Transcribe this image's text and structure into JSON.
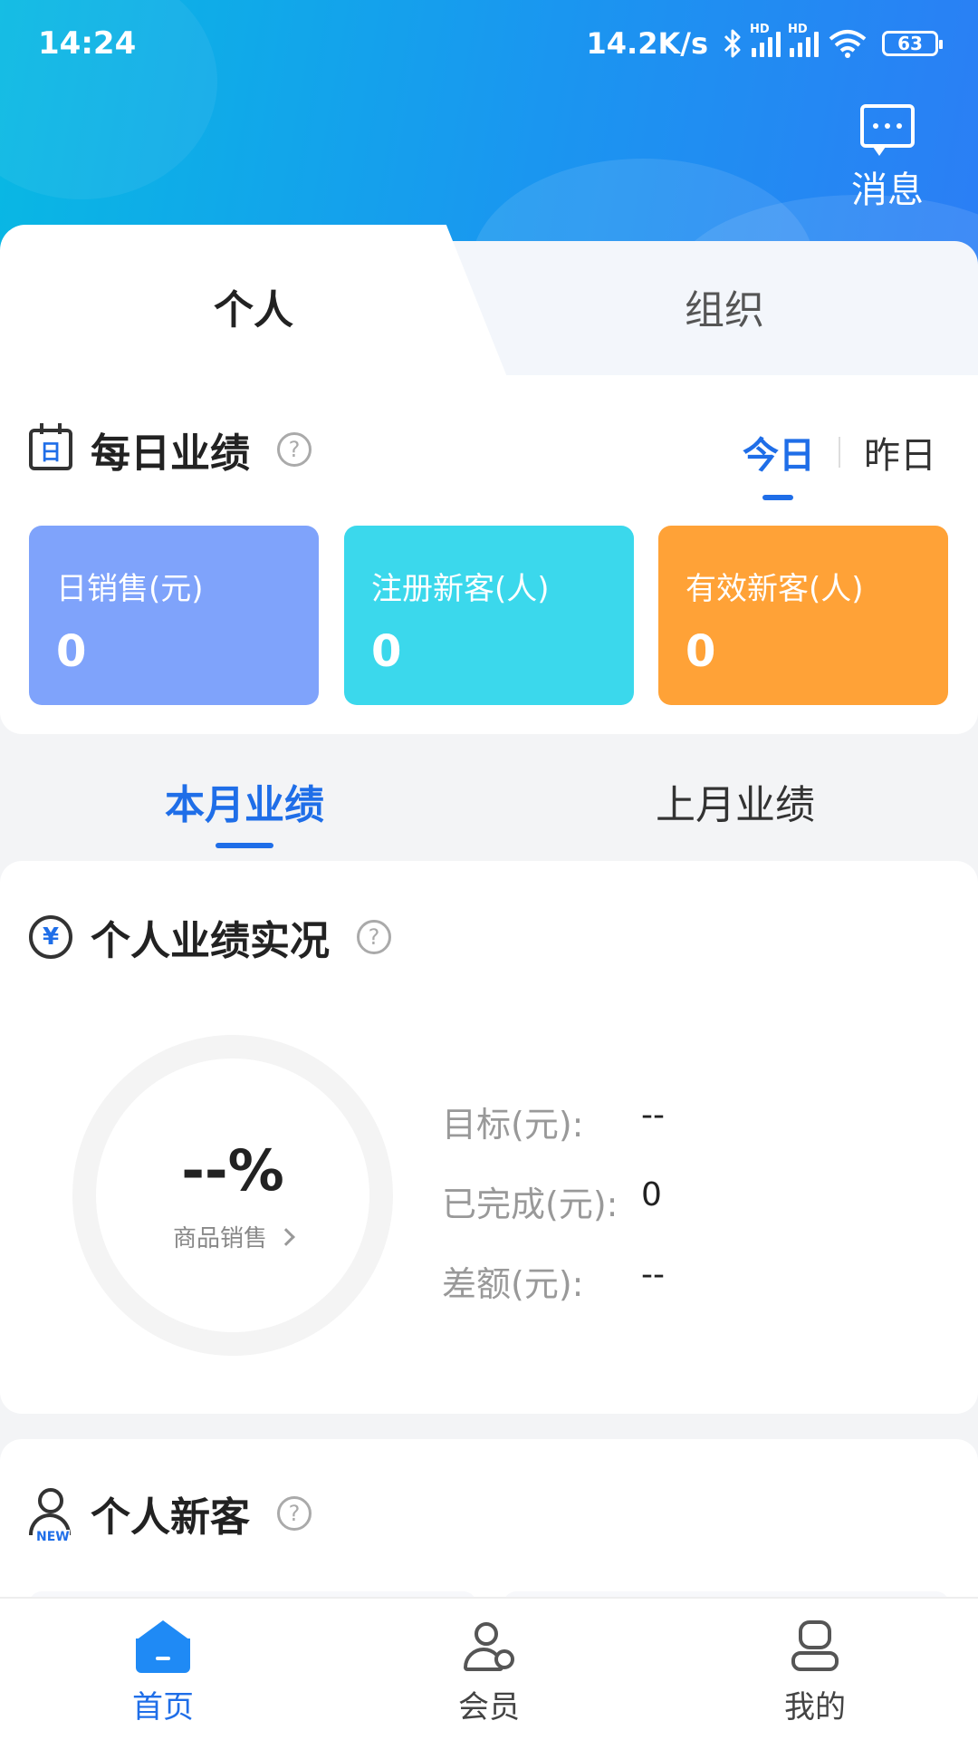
{
  "status_bar": {
    "time": "14:24",
    "net_speed": "14.2K/s",
    "hd1": "HD",
    "hd2": "HD",
    "battery": "63",
    "icons": [
      "bluetooth-icon",
      "signal-icon",
      "signal-icon",
      "wifi-icon",
      "battery-icon"
    ]
  },
  "header": {
    "message_label": "消息"
  },
  "scope_tabs": {
    "personal": "个人",
    "organization": "组织",
    "active": "personal"
  },
  "daily": {
    "title": "每日业绩",
    "calendar_glyph": "日",
    "help": "?",
    "today": "今日",
    "yesterday": "昨日",
    "active": "today",
    "stats": [
      {
        "label": "日销售(元)",
        "value": "0",
        "color": "#7fa3fb"
      },
      {
        "label": "注册新客(人)",
        "value": "0",
        "color": "#3bd8ec"
      },
      {
        "label": "有效新客(人)",
        "value": "0",
        "color": "#ffa237"
      }
    ]
  },
  "month_tabs": {
    "current": "本月业绩",
    "previous": "上月业绩",
    "active": "current"
  },
  "performance": {
    "title": "个人业绩实况",
    "yen_glyph": "¥",
    "help": "?",
    "percent": "--%",
    "ring_label": "商品销售",
    "rows": [
      {
        "key": "目标(元):",
        "value": "--"
      },
      {
        "key": "已完成(元):",
        "value": "0"
      },
      {
        "key": "差额(元):",
        "value": "--"
      }
    ]
  },
  "new_customers": {
    "title": "个人新客",
    "badge": "NEW",
    "help": "?"
  },
  "bottom_nav": {
    "items": [
      {
        "label": "首页",
        "icon": "home-icon",
        "active": true
      },
      {
        "label": "会员",
        "icon": "member-icon",
        "active": false
      },
      {
        "label": "我的",
        "icon": "me-icon",
        "active": false
      }
    ]
  },
  "colors": {
    "accent": "#1f6ee8",
    "header_start": "#08b9e3",
    "header_end": "#2b7ef5"
  }
}
